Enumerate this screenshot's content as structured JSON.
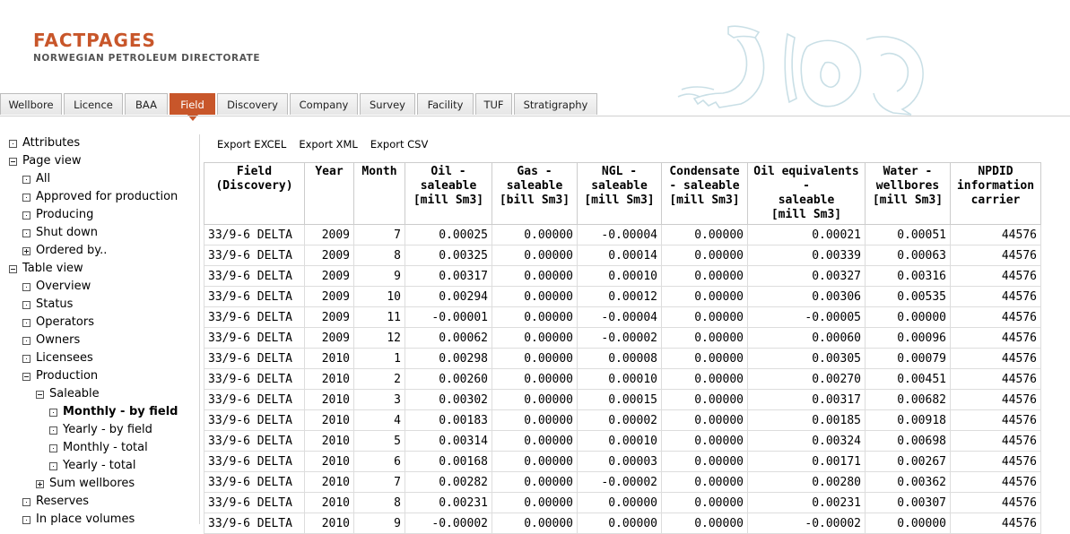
{
  "header": {
    "title": "FACTPAGES",
    "subtitle": "NORWEGIAN PETROLEUM DIRECTORATE"
  },
  "tabs": [
    {
      "label": "Wellbore",
      "active": false
    },
    {
      "label": "Licence",
      "active": false
    },
    {
      "label": "BAA",
      "active": false
    },
    {
      "label": "Field",
      "active": true
    },
    {
      "label": "Discovery",
      "active": false
    },
    {
      "label": "Company",
      "active": false
    },
    {
      "label": "Survey",
      "active": false
    },
    {
      "label": "Facility",
      "active": false
    },
    {
      "label": "TUF",
      "active": false
    },
    {
      "label": "Stratigraphy",
      "active": false
    }
  ],
  "tree": [
    {
      "label": "Attributes",
      "state": "dot",
      "level": 0
    },
    {
      "label": "Page view",
      "state": "minus",
      "level": 0
    },
    {
      "label": "All",
      "state": "dot",
      "level": 1
    },
    {
      "label": "Approved for production",
      "state": "dot",
      "level": 1
    },
    {
      "label": "Producing",
      "state": "dot",
      "level": 1
    },
    {
      "label": "Shut down",
      "state": "dot",
      "level": 1
    },
    {
      "label": "Ordered by..",
      "state": "plus",
      "level": 1
    },
    {
      "label": "Table view",
      "state": "minus",
      "level": 0
    },
    {
      "label": "Overview",
      "state": "dot",
      "level": 1
    },
    {
      "label": "Status",
      "state": "dot",
      "level": 1
    },
    {
      "label": "Operators",
      "state": "dot",
      "level": 1
    },
    {
      "label": "Owners",
      "state": "dot",
      "level": 1
    },
    {
      "label": "Licensees",
      "state": "dot",
      "level": 1
    },
    {
      "label": "Production",
      "state": "minus",
      "level": 1
    },
    {
      "label": "Saleable",
      "state": "minus",
      "level": 2
    },
    {
      "label": "Monthly - by field",
      "state": "dot",
      "level": 3,
      "bold": true
    },
    {
      "label": "Yearly - by field",
      "state": "dot",
      "level": 3
    },
    {
      "label": "Monthly - total",
      "state": "dot",
      "level": 3
    },
    {
      "label": "Yearly - total",
      "state": "dot",
      "level": 3
    },
    {
      "label": "Sum wellbores",
      "state": "plus",
      "level": 2
    },
    {
      "label": "Reserves",
      "state": "dot",
      "level": 1
    },
    {
      "label": "In place volumes",
      "state": "dot",
      "level": 1
    }
  ],
  "exports": [
    "Export EXCEL",
    "Export XML",
    "Export CSV"
  ],
  "table": {
    "headers": [
      [
        "Field",
        "(Discovery)"
      ],
      [
        "Year"
      ],
      [
        "Month"
      ],
      [
        "Oil -",
        "saleable",
        "[mill Sm3]"
      ],
      [
        "Gas -",
        "saleable",
        "[bill Sm3]"
      ],
      [
        "NGL -",
        "saleable",
        "[mill Sm3]"
      ],
      [
        "Condensate",
        "- saleable",
        "[mill Sm3]"
      ],
      [
        "Oil equivalents -",
        "saleable",
        "[mill Sm3]"
      ],
      [
        "Water -",
        "wellbores",
        "[mill Sm3]"
      ],
      [
        "NPDID",
        "information",
        "carrier"
      ]
    ],
    "rows": [
      [
        "33/9-6 DELTA",
        "2009",
        "7",
        "0.00025",
        "0.00000",
        "-0.00004",
        "0.00000",
        "0.00021",
        "0.00051",
        "44576"
      ],
      [
        "33/9-6 DELTA",
        "2009",
        "8",
        "0.00325",
        "0.00000",
        "0.00014",
        "0.00000",
        "0.00339",
        "0.00063",
        "44576"
      ],
      [
        "33/9-6 DELTA",
        "2009",
        "9",
        "0.00317",
        "0.00000",
        "0.00010",
        "0.00000",
        "0.00327",
        "0.00316",
        "44576"
      ],
      [
        "33/9-6 DELTA",
        "2009",
        "10",
        "0.00294",
        "0.00000",
        "0.00012",
        "0.00000",
        "0.00306",
        "0.00535",
        "44576"
      ],
      [
        "33/9-6 DELTA",
        "2009",
        "11",
        "-0.00001",
        "0.00000",
        "-0.00004",
        "0.00000",
        "-0.00005",
        "0.00000",
        "44576"
      ],
      [
        "33/9-6 DELTA",
        "2009",
        "12",
        "0.00062",
        "0.00000",
        "-0.00002",
        "0.00000",
        "0.00060",
        "0.00096",
        "44576"
      ],
      [
        "33/9-6 DELTA",
        "2010",
        "1",
        "0.00298",
        "0.00000",
        "0.00008",
        "0.00000",
        "0.00305",
        "0.00079",
        "44576"
      ],
      [
        "33/9-6 DELTA",
        "2010",
        "2",
        "0.00260",
        "0.00000",
        "0.00010",
        "0.00000",
        "0.00270",
        "0.00451",
        "44576"
      ],
      [
        "33/9-6 DELTA",
        "2010",
        "3",
        "0.00302",
        "0.00000",
        "0.00015",
        "0.00000",
        "0.00317",
        "0.00682",
        "44576"
      ],
      [
        "33/9-6 DELTA",
        "2010",
        "4",
        "0.00183",
        "0.00000",
        "0.00002",
        "0.00000",
        "0.00185",
        "0.00918",
        "44576"
      ],
      [
        "33/9-6 DELTA",
        "2010",
        "5",
        "0.00314",
        "0.00000",
        "0.00010",
        "0.00000",
        "0.00324",
        "0.00698",
        "44576"
      ],
      [
        "33/9-6 DELTA",
        "2010",
        "6",
        "0.00168",
        "0.00000",
        "0.00003",
        "0.00000",
        "0.00171",
        "0.00267",
        "44576"
      ],
      [
        "33/9-6 DELTA",
        "2010",
        "7",
        "0.00282",
        "0.00000",
        "-0.00002",
        "0.00000",
        "0.00280",
        "0.00362",
        "44576"
      ],
      [
        "33/9-6 DELTA",
        "2010",
        "8",
        "0.00231",
        "0.00000",
        "0.00000",
        "0.00000",
        "0.00231",
        "0.00307",
        "44576"
      ],
      [
        "33/9-6 DELTA",
        "2010",
        "9",
        "-0.00002",
        "0.00000",
        "0.00000",
        "0.00000",
        "-0.00002",
        "0.00000",
        "44576"
      ]
    ]
  },
  "colors": {
    "accent": "#c8562a",
    "lion": "#c9dfe6"
  }
}
